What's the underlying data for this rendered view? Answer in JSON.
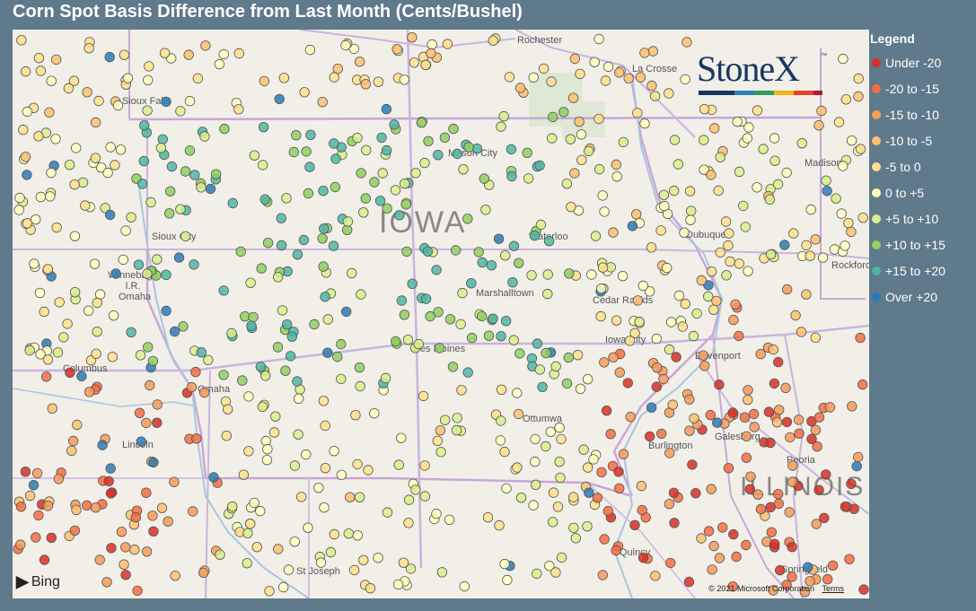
{
  "title": "Corn Spot Basis Difference from Last Month (Cents/Bushel)",
  "legend": {
    "title": "Legend",
    "items": [
      {
        "label": "Under -20",
        "color": "#d73027"
      },
      {
        "label": "-20 to -15",
        "color": "#f46d43"
      },
      {
        "label": "-15 to -10",
        "color": "#f79a5a"
      },
      {
        "label": "-10 to -5",
        "color": "#fdbf6f"
      },
      {
        "label": "-5 to 0",
        "color": "#fee08b"
      },
      {
        "label": "0 to +5",
        "color": "#ffffbf"
      },
      {
        "label": "+5 to +10",
        "color": "#d9ef8b"
      },
      {
        "label": "+10 to +15",
        "color": "#91cf60"
      },
      {
        "label": "+15 to +20",
        "color": "#4db6a4"
      },
      {
        "label": "Over +20",
        "color": "#2c7bb6"
      }
    ]
  },
  "logo": {
    "text": "StoneX",
    "tm": "™"
  },
  "map_labels": {
    "state_iowa": "IOWA",
    "state_illinois": "ILLINOIS",
    "cities": [
      "Rochester",
      "La Crosse",
      "Sioux Falls",
      "Mason City",
      "Madison",
      "Waterloo",
      "Dubuque",
      "Sioux City",
      "Winnebago I.R.",
      "Omaha",
      "Rockford",
      "Marshalltown",
      "Cedar Rapids",
      "Iowa City",
      "Davenport",
      "Des Moines",
      "Columbus",
      "Omaha",
      "Ottumwa",
      "Galesburg",
      "Burlington",
      "Lincoln",
      "Peoria",
      "Quincy",
      "St Joseph",
      "Springfield"
    ]
  },
  "attribution": {
    "bing": "Bing",
    "copyright": "© 2021 Microsoft Corporation",
    "terms": "Terms"
  }
}
